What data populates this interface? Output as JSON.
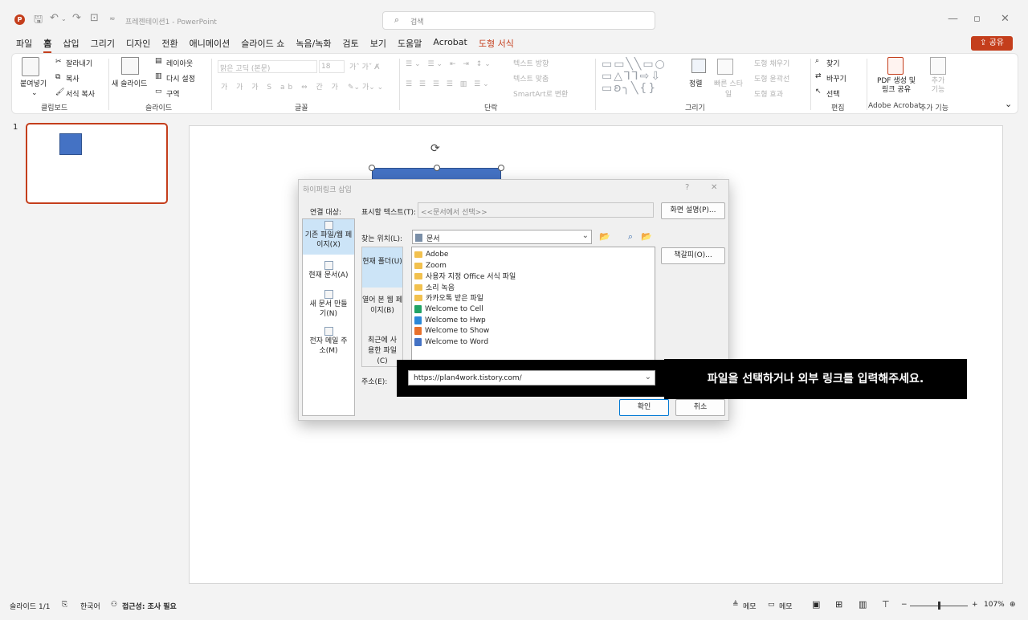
{
  "titlebar": {
    "app_logo": "P",
    "doc_title": "프레젠테이션1 - PowerPoint",
    "search_placeholder": "검색",
    "undo_icon": "undo-icon",
    "save_icon": "save-icon"
  },
  "menu": {
    "tabs": [
      "파일",
      "홈",
      "삽입",
      "그리기",
      "디자인",
      "전환",
      "애니메이션",
      "슬라이드 쇼",
      "녹음/녹화",
      "검토",
      "보기",
      "도움말",
      "Acrobat",
      "도형 서식"
    ],
    "share": "공유"
  },
  "ribbon": {
    "clipboard": {
      "paste": "붙여넣기",
      "cut": "잘라내기",
      "copy": "복사",
      "format_painter": "서식 복사",
      "label": "클립보드"
    },
    "slides": {
      "new_slide": "새 슬라이드",
      "layout": "레이아웃",
      "reset": "다시 설정",
      "section": "구역",
      "label": "슬라이드"
    },
    "font": {
      "font_name": "맑은 고딕 (본문)",
      "font_size": "18",
      "label": "글꼴"
    },
    "paragraph": {
      "text_direction": "텍스트 방향",
      "align_text": "텍스트 맞춤",
      "smartart": "SmartArt로 변환",
      "label": "단락"
    },
    "drawing": {
      "arrange": "정렬",
      "quick_styles": "빠른 스타일",
      "fill": "도형 채우기",
      "outline": "도형 윤곽선",
      "effects": "도형 효과",
      "label": "그리기"
    },
    "editing": {
      "find": "찾기",
      "replace": "바꾸기",
      "select": "선택",
      "label": "편집"
    },
    "acrobat": {
      "create_pdf": "PDF 생성 및 링크 공유",
      "label": "Adobe Acrobat"
    },
    "addins": {
      "addins": "추가 기능",
      "label": "추가 기능"
    }
  },
  "slidepane": {
    "slide_number": "1"
  },
  "dialog": {
    "title": "하이퍼링크 삽입",
    "help": "?",
    "close": "✕",
    "link_to_label": "연결 대상:",
    "link_to": [
      {
        "label": "기존 파일/웹 페이지(X)"
      },
      {
        "label": "현재 문서(A)"
      },
      {
        "label": "새 문서 만들기(N)"
      },
      {
        "label": "전자 메일 주소(M)"
      }
    ],
    "display_text_label": "표시할 텍스트(T):",
    "display_text_value": "<<문서에서 선택>>",
    "screentip_button": "화면 설명(P)...",
    "look_in_label": "찾는 위치(L):",
    "look_in_value": "문서",
    "bookmark_button": "책갈피(O)...",
    "subnav": [
      {
        "label": "현재 폴더(U)"
      },
      {
        "label": "열어 본 웹 페이지(B)"
      },
      {
        "label": "최근에 사용한 파일(C)"
      }
    ],
    "files": [
      {
        "name": "Adobe",
        "type": "folder"
      },
      {
        "name": "Zoom",
        "type": "folder"
      },
      {
        "name": "사용자 지정 Office 서식 파일",
        "type": "folder"
      },
      {
        "name": "소리 녹음",
        "type": "folder"
      },
      {
        "name": "카카오톡 받은 파일",
        "type": "folder"
      },
      {
        "name": "Welcome to Cell",
        "type": "cell"
      },
      {
        "name": "Welcome to Hwp",
        "type": "hwp"
      },
      {
        "name": "Welcome to Show",
        "type": "show"
      },
      {
        "name": "Welcome to Word",
        "type": "word"
      }
    ],
    "address_label": "주소(E):",
    "address_value": "https://plan4work.tistory.com/",
    "ok_button": "확인",
    "cancel_button": "취소"
  },
  "callout": {
    "text": "파일을 선택하거나 외부 링크를 입력해주세요."
  },
  "statusbar": {
    "slide_info": "슬라이드 1/1",
    "language": "한국어",
    "accessibility": "접근성: 조사 필요",
    "notes": "메모",
    "comments": "메모",
    "zoom_percent": "107%"
  },
  "colors": {
    "accent": "#c43e1c",
    "shape_fill": "#4472c4",
    "selection": "#cce4f7",
    "folder": "#f2c14e",
    "cell": "#21a366",
    "hwp": "#2b88d8",
    "show": "#e8712b",
    "word": "#4472c4"
  }
}
